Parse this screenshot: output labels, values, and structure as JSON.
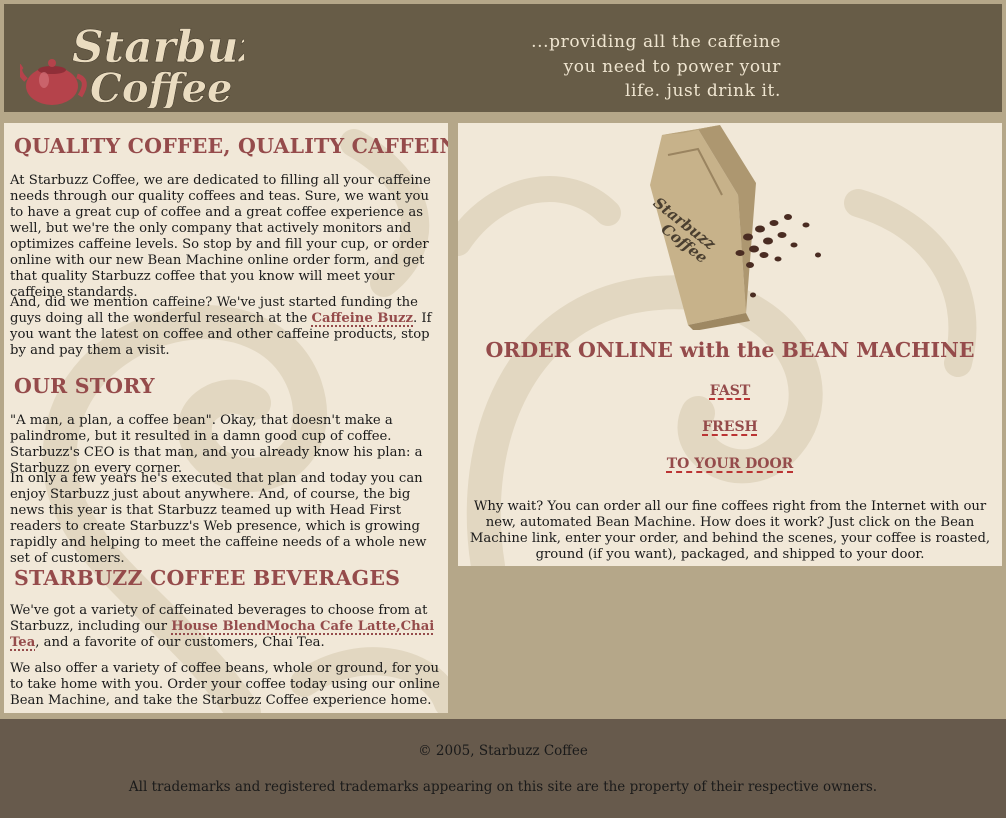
{
  "header": {
    "logo": {
      "line1": "Starbuzz",
      "line2": "Coffee"
    },
    "tagline": [
      "...providing all the caffeine",
      "you need to power your",
      "life. just drink it."
    ]
  },
  "main": {
    "sections": [
      {
        "title": "QUALITY COFFEE, QUALITY CAFFEINE",
        "paragraphs": [
          "At Starbuzz Coffee, we are dedicated to filling all your caffeine needs through our quality coffees and teas. Sure, we want you to have a great cup of coffee and a great coffee experience as well, but we're the only company that actively monitors and optimizes caffeine levels. So stop by and fill your cup, or order online with our new Bean Machine online order form, and get that quality Starbuzz coffee that you know will meet your caffeine standards."
        ],
        "p2": {
          "before": "And, did we mention caffeine? We've just started funding the guys doing all the wonderful research at the ",
          "link": "Caffeine Buzz",
          "after": ". If you want the latest on coffee and other caffeine products, stop by and pay them a visit."
        }
      },
      {
        "title": "OUR STORY",
        "paragraphs": [
          "\"A man, a plan, a coffee bean\". Okay, that doesn't make a palindrome, but it resulted in a damn good cup of coffee. Starbuzz's CEO is that man, and you already know his plan: a Starbuzz on every corner.",
          "In only a few years he's executed that plan and today you can enjoy Starbuzz just about anywhere. And, of course, the big news this year is that Starbuzz teamed up with Head First readers to create Starbuzz's Web presence, which is growing rapidly and helping to meet the caffeine needs of a whole new set of customers."
        ]
      },
      {
        "title": "STARBUZZ COFFEE BEVERAGES",
        "p1": {
          "before": "We've got a variety of caffeinated beverages to choose from at Starbuzz, including our ",
          "link": "House BlendMocha Cafe Latte,Chai Tea",
          "after": ", and a favorite of our customers, Chai Tea."
        },
        "paragraphs": [
          "We also offer a variety of coffee beans, whole or ground, for you to take home with you. Order your coffee today using our online Bean Machine, and take the Starbuzz Coffee experience home."
        ]
      }
    ]
  },
  "sidebar": {
    "bag_label": [
      "Starbuzz",
      "Coffee"
    ],
    "order_title": "ORDER ONLINE with the BEAN MACHINE",
    "links": [
      "FAST",
      "FRESH",
      "TO YOUR DOOR"
    ],
    "why": "Why wait? You can order all our fine coffees right from the Internet with our new, automated Bean Machine. How does it work? Just click on the Bean Machine link, enter your order, and behind the scenes, your coffee is roasted, ground (if you want), packaged, and shipped to your door."
  },
  "footer": {
    "copyright": "© 2005, Starbuzz Coffee",
    "trademark": "All trademarks and registered trademarks appearing on this site are the property of their respective owners."
  },
  "colors": {
    "header_bg": "#675c47",
    "page_bg": "#b5a789",
    "panel_bg": "#f1e8d8",
    "heading": "#954b4b",
    "footer_bg": "#675a4c"
  }
}
